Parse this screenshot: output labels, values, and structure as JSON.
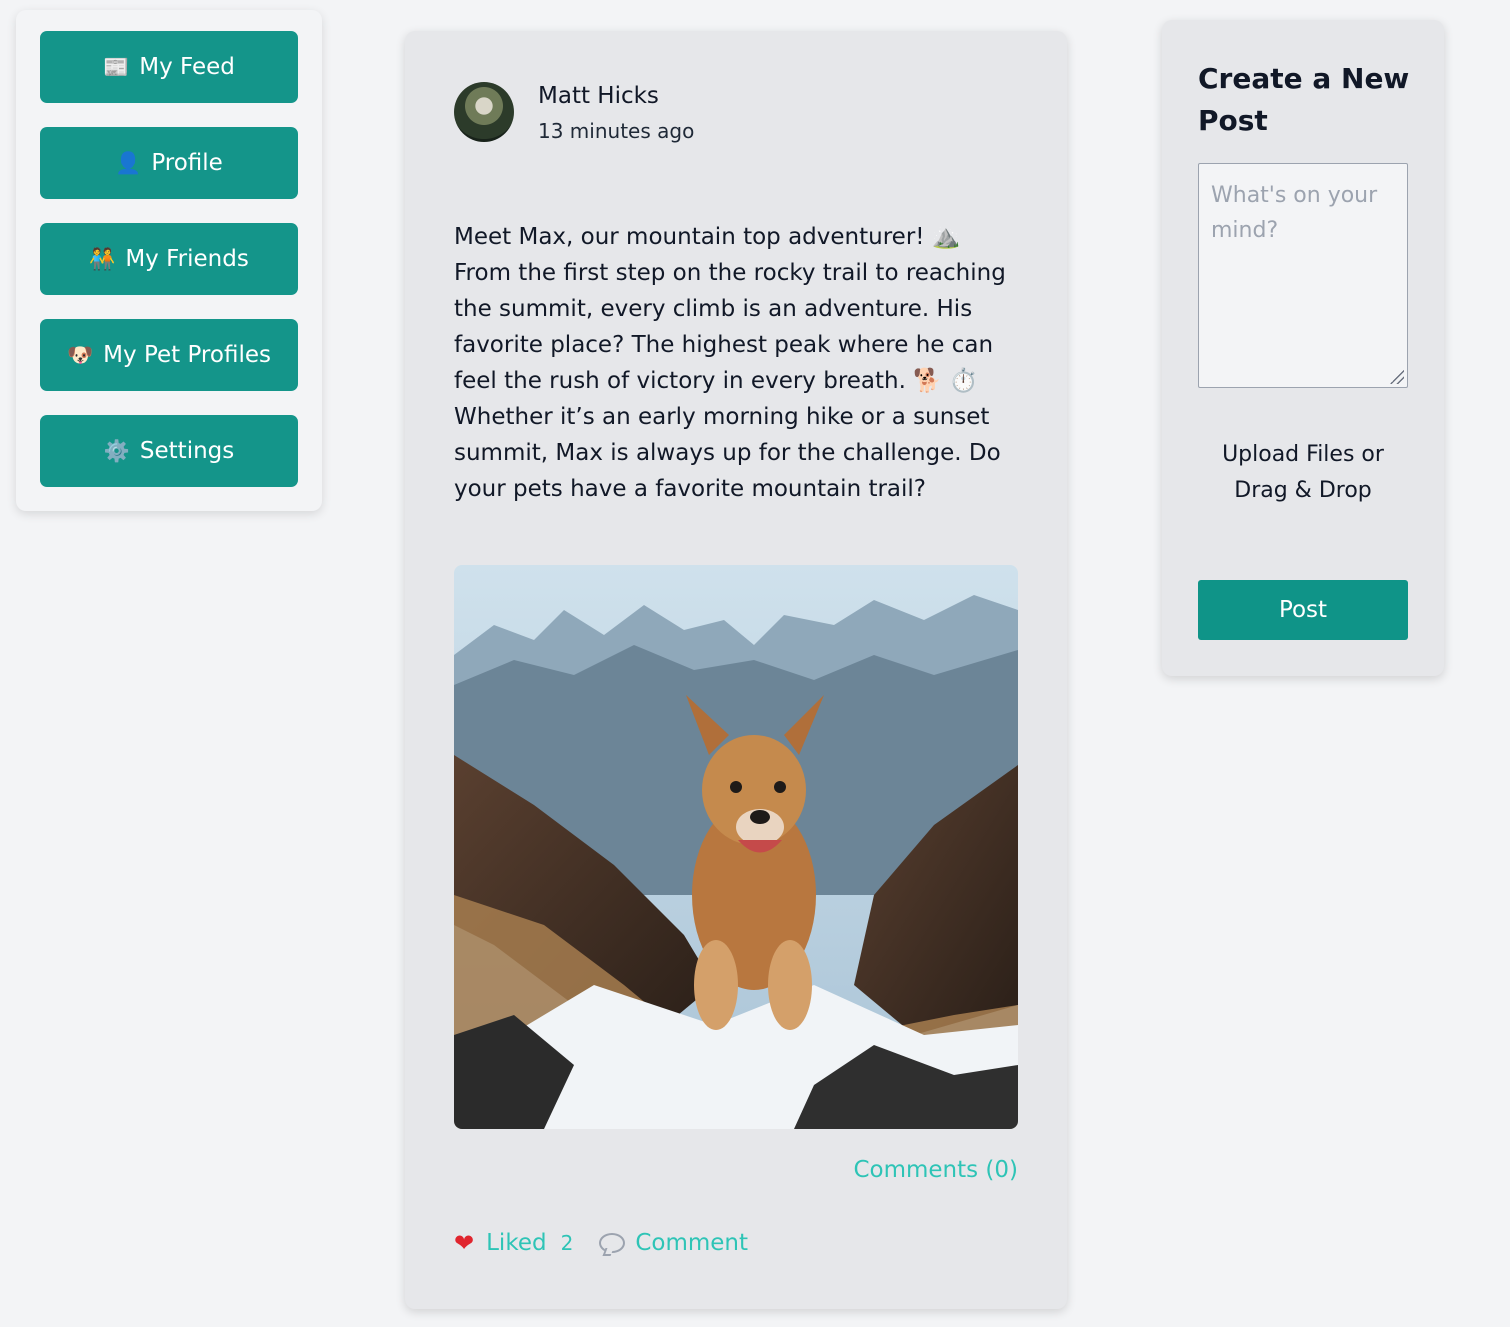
{
  "nav": {
    "items": [
      {
        "icon": "📰",
        "icon_name": "newspaper-icon",
        "label": "My Feed"
      },
      {
        "icon": "👤",
        "icon_name": "person-icon",
        "label": "Profile"
      },
      {
        "icon": "🧑‍🤝‍🧑",
        "icon_name": "friends-icon",
        "label": "My Friends"
      },
      {
        "icon": "🐶",
        "icon_name": "dog-face-icon",
        "label": "My Pet Profiles"
      },
      {
        "icon": "⚙️",
        "icon_name": "gear-icon",
        "label": "Settings"
      }
    ]
  },
  "post": {
    "author": "Matt Hicks",
    "time": "13 minutes ago",
    "text_parts": [
      "Meet Max, our mountain top adventurer! ",
      "⛰️",
      " From the first step on the rocky trail to reaching the summit, every climb is an adventure. His favorite place? The highest peak where he can feel the rush of victory in every breath. ",
      "🐕",
      " ",
      "⏱️",
      " Whether it’s an early morning hike or a sunset summit, Max is always up for the challenge. Do your pets have a favorite mountain trail?"
    ],
    "comments_link": "Comments (0)",
    "liked_label": "Liked",
    "like_count": "2",
    "comment_label": "Comment"
  },
  "create_post": {
    "title": "Create a New Post",
    "placeholder": "What's on your mind?",
    "upload_label": "Upload Files or Drag & Drop",
    "post_button": "Post"
  },
  "colors": {
    "accent": "#14958a",
    "link": "#2ec4b6",
    "heart": "#e0252e",
    "background": "#f3f4f6",
    "card": "#e6e7ea"
  }
}
